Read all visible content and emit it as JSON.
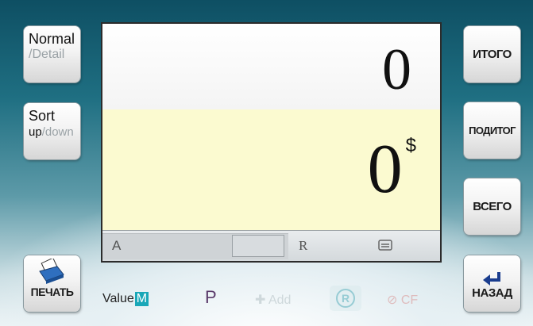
{
  "left_buttons": {
    "mode": {
      "line1": "Normal",
      "line2": "/Detail"
    },
    "sort": {
      "line1": "Sort",
      "up": "up",
      "down": "/down"
    },
    "print": {
      "label": "ПЕЧАТЬ",
      "icon": "printer-icon"
    }
  },
  "right_buttons": {
    "total": "ИТОГО",
    "subtotal": "ПОДИТОГ",
    "grand_total": "ВСЕГО",
    "back": {
      "label": "НАЗАД",
      "icon": "back-arrow-icon"
    }
  },
  "display": {
    "count_value": "0",
    "amount_value": "0",
    "currency": "$",
    "status": {
      "a": "A",
      "r": "R",
      "icon": "batch-icon"
    }
  },
  "bottom_bar": {
    "value_label": "Value",
    "value_badge": "M",
    "p_label": "P",
    "add_label": "Add",
    "r_label": "R",
    "cf_label": "CF"
  },
  "colors": {
    "amount_pane": "#fbfad0",
    "value_badge": "#19a7b8",
    "background_dark": "#0e4f63"
  }
}
